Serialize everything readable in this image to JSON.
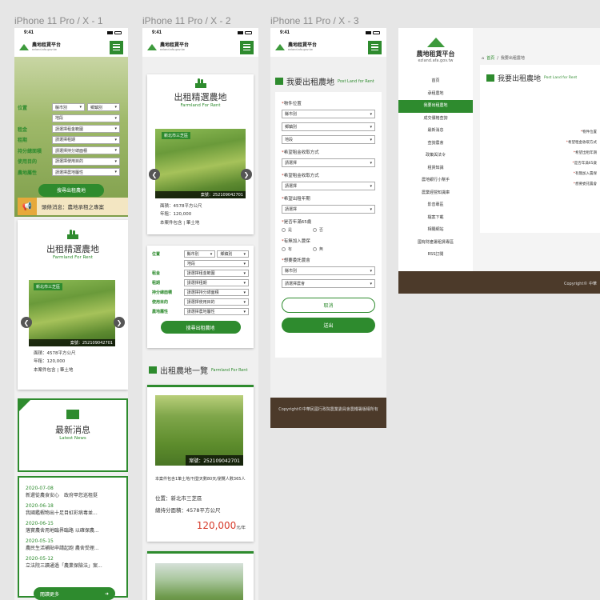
{
  "artboards": [
    "iPhone 11 Pro / X - 1",
    "iPhone 11 Pro / X - 2",
    "iPhone 11 Pro / X - 3"
  ],
  "status_time": "9:41",
  "site": {
    "title": "農地租賃平台",
    "url": "ezland.afa.gov.tw"
  },
  "search": {
    "labels": {
      "location": "位置",
      "rent": "租金",
      "period": "租期",
      "area": "持分總面積",
      "purpose": "使用目的",
      "attr": "農地屬性"
    },
    "county": "縣市別",
    "town": "鄉鎮別",
    "section": "地段",
    "rent_ph": "請選擇租金範圍",
    "period_ph": "請選擇租期",
    "area_ph": "請選擇持分總面積",
    "purpose_ph": "請選擇使用目的",
    "attr_ph": "請選擇農地屬性",
    "button": "搜尋出租農地"
  },
  "notice": "頭條消息：農地承租之專案",
  "featured": {
    "title": "出租精選農地",
    "subtitle": "Farmland For Rent",
    "location": "新北市三芝區",
    "case_no": "案號：252109042701",
    "area": "面積：4578平方公尺",
    "rent": "年租：120,000",
    "note": "本案件包含 | 筆土地"
  },
  "news": {
    "title": "最新消息",
    "subtitle": "Latest News",
    "items": [
      {
        "date": "2020-07-08",
        "title": "新還從農食安心　政府甲您巡租挺"
      },
      {
        "date": "2020-06-18",
        "title": "我國鑑蝦物出十足目虹彩病毒並..."
      },
      {
        "date": "2020-06-15",
        "title": "落實農舍用地臨界臨路 以確保農..."
      },
      {
        "date": "2020-05-15",
        "title": "農民生活補貼申請起跑 農舍受理..."
      },
      {
        "date": "2020-05-12",
        "title": "立法院三讀通過「農業保險法」案..."
      }
    ],
    "more": "閱讀更多"
  },
  "list": {
    "title": "出租農地一覽",
    "subtitle": "Farmland For Rent",
    "case_no": "案號：252109042701",
    "desc": "本案件包含1筆土地/刊登天數80天/瀏覽人數365人",
    "location": "位置：新北市三芝區",
    "area": "總持分面積：4578平方公尺",
    "price": "120,000",
    "unit": "元/年"
  },
  "form": {
    "title": "我要出租農地",
    "subtitle": "Post Land for Rent",
    "f1": "物件位置",
    "f2": "希望租金收取方式",
    "f3": "希望租金收取方式",
    "f4": "希望出租年期",
    "f5": "是否年滿65歲",
    "f6": "有無加入農保",
    "f7": "想要委託農會",
    "county": "縣市別",
    "town": "鄉鎮別",
    "section": "地段",
    "choose": "請選擇",
    "farmer_choose": "請選擇農會",
    "yes": "是",
    "no": "否",
    "have": "有",
    "none": "無",
    "cancel": "取消",
    "submit": "送出"
  },
  "copyright": "Copyright©中華民國行政院農業委員會農糧署版權所有",
  "desktop": {
    "breadcrumb_home": "首頁",
    "breadcrumb_current": "我要出租農地",
    "title": "我要出租農地",
    "subtitle": "Post Land for Rent",
    "menu": [
      "首頁",
      "承租農地",
      "我要出租農地",
      "成交價格查詢",
      "最新消息",
      "查詢農會",
      "政策與法令",
      "租賃知識",
      "農地銀行小幫手",
      "農業經營知識庫",
      "影音專區",
      "檔案下載",
      "相關網站",
      "國有財產署租賃專區",
      "RSS訂閱"
    ],
    "fields": [
      "物件位置",
      "希望租金收取方式",
      "希望出租年期",
      "是否年滿65歲",
      "有無加入農保",
      "想要委託農會"
    ],
    "copyright": "Copyright© 中華"
  }
}
